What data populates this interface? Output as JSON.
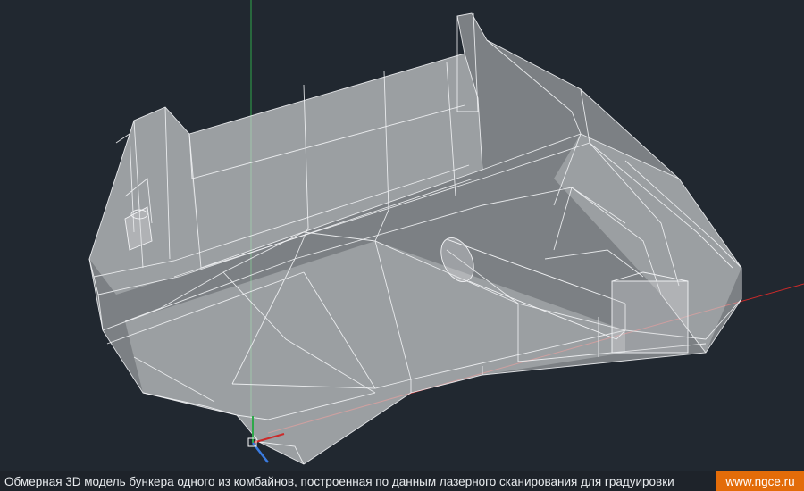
{
  "viewport": {
    "background": "#212830",
    "model_fill": "#c8c9cb",
    "edge_color": "#f2f3f5",
    "axis_colors": {
      "x": "#cc2a2a",
      "y": "#2ea84a",
      "z": "#3a7be0"
    }
  },
  "caption": {
    "text": "Обмерная 3D модель бункера одного из комбайнов, построенная по данным лазерного сканирования для градуировки",
    "site": "www.ngce.ru",
    "site_color": "#e36c09"
  }
}
